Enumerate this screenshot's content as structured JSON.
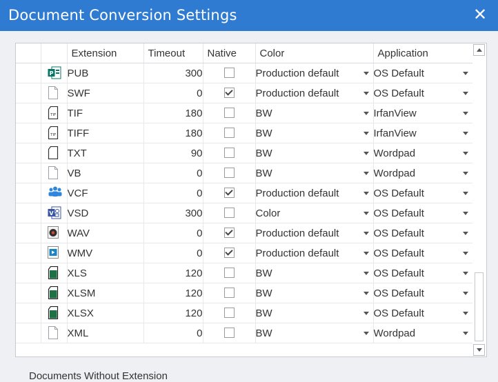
{
  "window": {
    "title": "Document Conversion Settings"
  },
  "columns": {
    "extension": "Extension",
    "timeout": "Timeout",
    "native": "Native",
    "color": "Color",
    "application": "Application"
  },
  "rows": [
    {
      "icon": "publisher-icon",
      "ext": "PUB",
      "timeout": "300",
      "native": false,
      "color": "Production default",
      "app": "OS Default"
    },
    {
      "icon": "file-icon",
      "ext": "SWF",
      "timeout": "0",
      "native": true,
      "color": "Production default",
      "app": "OS Default"
    },
    {
      "icon": "tif-icon",
      "ext": "TIF",
      "timeout": "180",
      "native": false,
      "color": "BW",
      "app": "IrfanView"
    },
    {
      "icon": "tif-icon",
      "ext": "TIFF",
      "timeout": "180",
      "native": false,
      "color": "BW",
      "app": "IrfanView"
    },
    {
      "icon": "text-file-icon",
      "ext": "TXT",
      "timeout": "90",
      "native": false,
      "color": "BW",
      "app": "Wordpad"
    },
    {
      "icon": "file-icon",
      "ext": "VB",
      "timeout": "0",
      "native": false,
      "color": "BW",
      "app": "Wordpad"
    },
    {
      "icon": "contacts-icon",
      "ext": "VCF",
      "timeout": "0",
      "native": true,
      "color": "Production default",
      "app": "OS Default"
    },
    {
      "icon": "visio-icon",
      "ext": "VSD",
      "timeout": "300",
      "native": false,
      "color": "Color",
      "app": "OS Default"
    },
    {
      "icon": "audio-icon",
      "ext": "WAV",
      "timeout": "0",
      "native": true,
      "color": "Production default",
      "app": "OS Default"
    },
    {
      "icon": "video-icon",
      "ext": "WMV",
      "timeout": "0",
      "native": true,
      "color": "Production default",
      "app": "OS Default"
    },
    {
      "icon": "excel-icon",
      "ext": "XLS",
      "timeout": "120",
      "native": false,
      "color": "BW",
      "app": "OS Default"
    },
    {
      "icon": "excel-icon",
      "ext": "XLSM",
      "timeout": "120",
      "native": false,
      "color": "BW",
      "app": "OS Default"
    },
    {
      "icon": "excel-icon",
      "ext": "XLSX",
      "timeout": "120",
      "native": false,
      "color": "BW",
      "app": "OS Default"
    },
    {
      "icon": "file-icon",
      "ext": "XML",
      "timeout": "0",
      "native": false,
      "color": "BW",
      "app": "Wordpad"
    }
  ],
  "below_label": "Documents Without Extension",
  "colors": {
    "titlebar": "#2f7bd2",
    "excel": "#1e7145",
    "publisher": "#077568",
    "visio": "#3955a3"
  }
}
